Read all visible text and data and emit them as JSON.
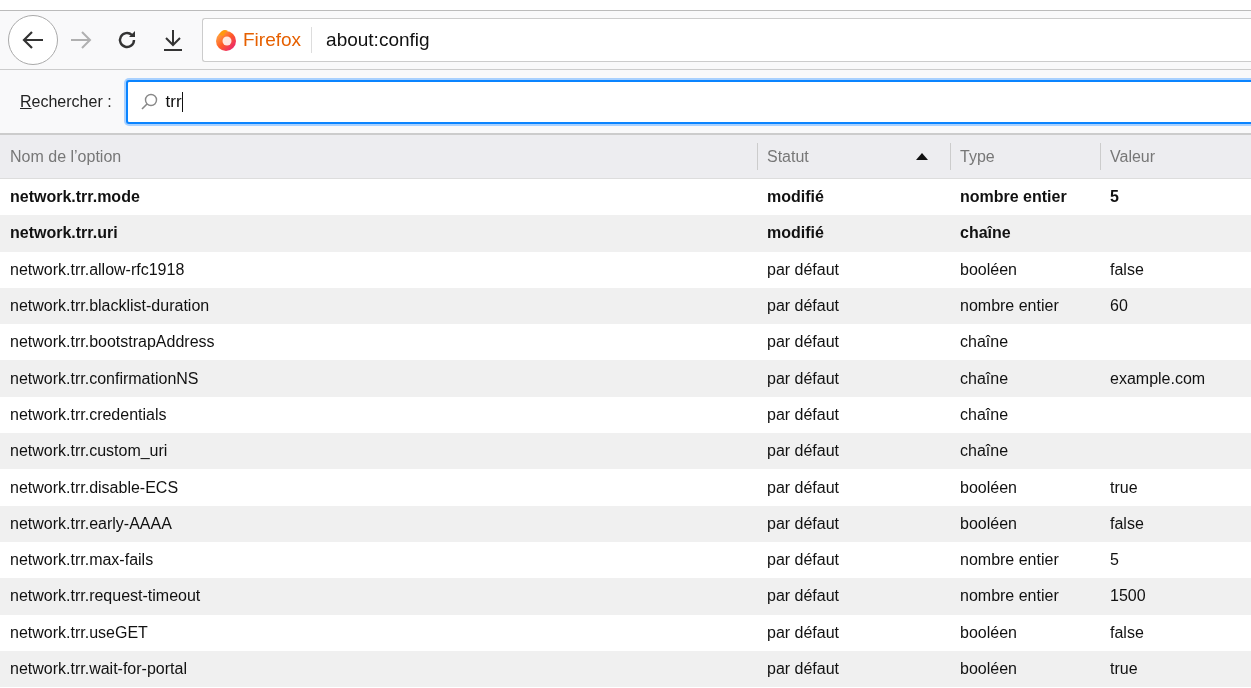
{
  "toolbar": {
    "identity": "Firefox",
    "url": "about:config",
    "forward_disabled": true
  },
  "search": {
    "label": "Rechercher :",
    "value": "trr"
  },
  "table": {
    "columns": [
      {
        "label": "Nom de l’option",
        "sorted": false
      },
      {
        "label": "Statut",
        "sorted": true
      },
      {
        "label": "Type",
        "sorted": false
      },
      {
        "label": "Valeur",
        "sorted": false
      }
    ],
    "rows": [
      {
        "name": "network.trr.mode",
        "status": "modifié",
        "type": "nombre entier",
        "value": "5",
        "modified": true
      },
      {
        "name": "network.trr.uri",
        "status": "modifié",
        "type": "chaîne",
        "value": "",
        "modified": true
      },
      {
        "name": "network.trr.allow-rfc1918",
        "status": "par défaut",
        "type": "booléen",
        "value": "false",
        "modified": false
      },
      {
        "name": "network.trr.blacklist-duration",
        "status": "par défaut",
        "type": "nombre entier",
        "value": "60",
        "modified": false
      },
      {
        "name": "network.trr.bootstrapAddress",
        "status": "par défaut",
        "type": "chaîne",
        "value": "",
        "modified": false
      },
      {
        "name": "network.trr.confirmationNS",
        "status": "par défaut",
        "type": "chaîne",
        "value": "example.com",
        "modified": false
      },
      {
        "name": "network.trr.credentials",
        "status": "par défaut",
        "type": "chaîne",
        "value": "",
        "modified": false
      },
      {
        "name": "network.trr.custom_uri",
        "status": "par défaut",
        "type": "chaîne",
        "value": "",
        "modified": false
      },
      {
        "name": "network.trr.disable-ECS",
        "status": "par défaut",
        "type": "booléen",
        "value": "true",
        "modified": false
      },
      {
        "name": "network.trr.early-AAAA",
        "status": "par défaut",
        "type": "booléen",
        "value": "false",
        "modified": false
      },
      {
        "name": "network.trr.max-fails",
        "status": "par défaut",
        "type": "nombre entier",
        "value": "5",
        "modified": false
      },
      {
        "name": "network.trr.request-timeout",
        "status": "par défaut",
        "type": "nombre entier",
        "value": "1500",
        "modified": false
      },
      {
        "name": "network.trr.useGET",
        "status": "par défaut",
        "type": "booléen",
        "value": "false",
        "modified": false
      },
      {
        "name": "network.trr.wait-for-portal",
        "status": "par défaut",
        "type": "booléen",
        "value": "true",
        "modified": false
      }
    ]
  }
}
